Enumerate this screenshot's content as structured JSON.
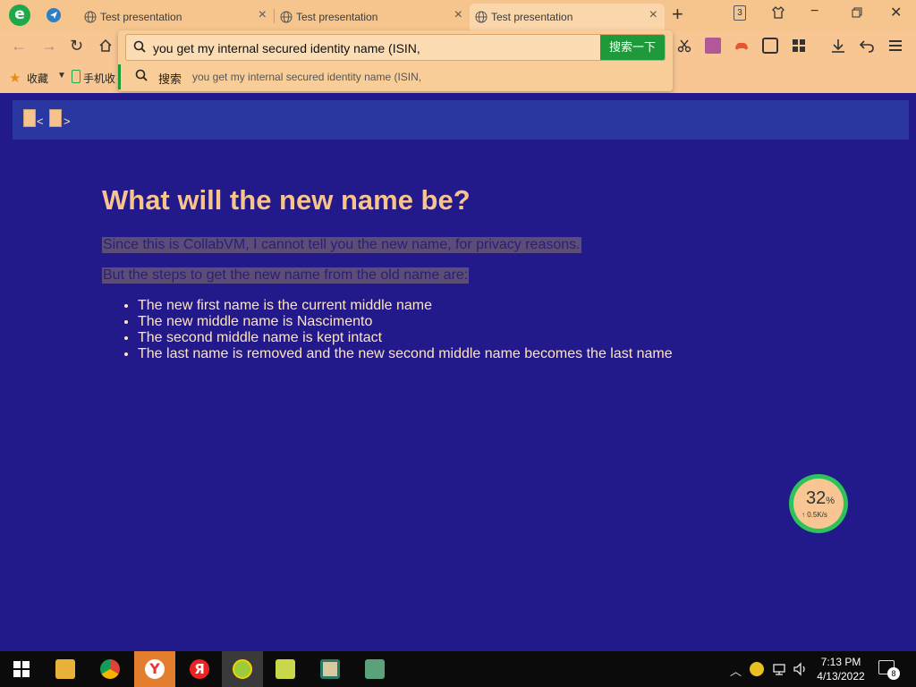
{
  "browser": {
    "tabs": [
      {
        "title": "Test presentation"
      },
      {
        "title": "Test presentation"
      },
      {
        "title": "Test presentation"
      }
    ],
    "tab_count": "3",
    "address": {
      "value": "you get my internal secured identity name  (ISIN,",
      "go_label": "搜索一下",
      "suggestion_keyword": "搜索",
      "suggestion_text": "you get my internal secured identity name (ISIN,"
    },
    "bookmarks": {
      "favorites_label": "收藏",
      "mobile_label": "手机收"
    }
  },
  "page": {
    "heading": "What will the new name be?",
    "paragraph1": "Since this is CollabVM, I cannot tell you the new name, for privacy reasons.",
    "paragraph2": "But the steps to get the new name from the old name are:",
    "bullets": [
      "The new first name is the current middle name",
      "The new middle name is Nascimento",
      "The second middle name is kept intact",
      "The last name is removed and the new second middle name becomes the last name"
    ],
    "nav_prev": "<",
    "nav_next": ">"
  },
  "net_widget": {
    "percent": "32",
    "percent_sign": "%",
    "speed": "↑ 0.5K/s"
  },
  "taskbar": {
    "time": "7:13 PM",
    "date": "4/13/2022",
    "notification_count": "8"
  },
  "colors": {
    "page_bg": "#22198a",
    "heading": "#f8c38c",
    "browser_chrome": "#f7c693",
    "accent_green": "#1f9a3a"
  }
}
